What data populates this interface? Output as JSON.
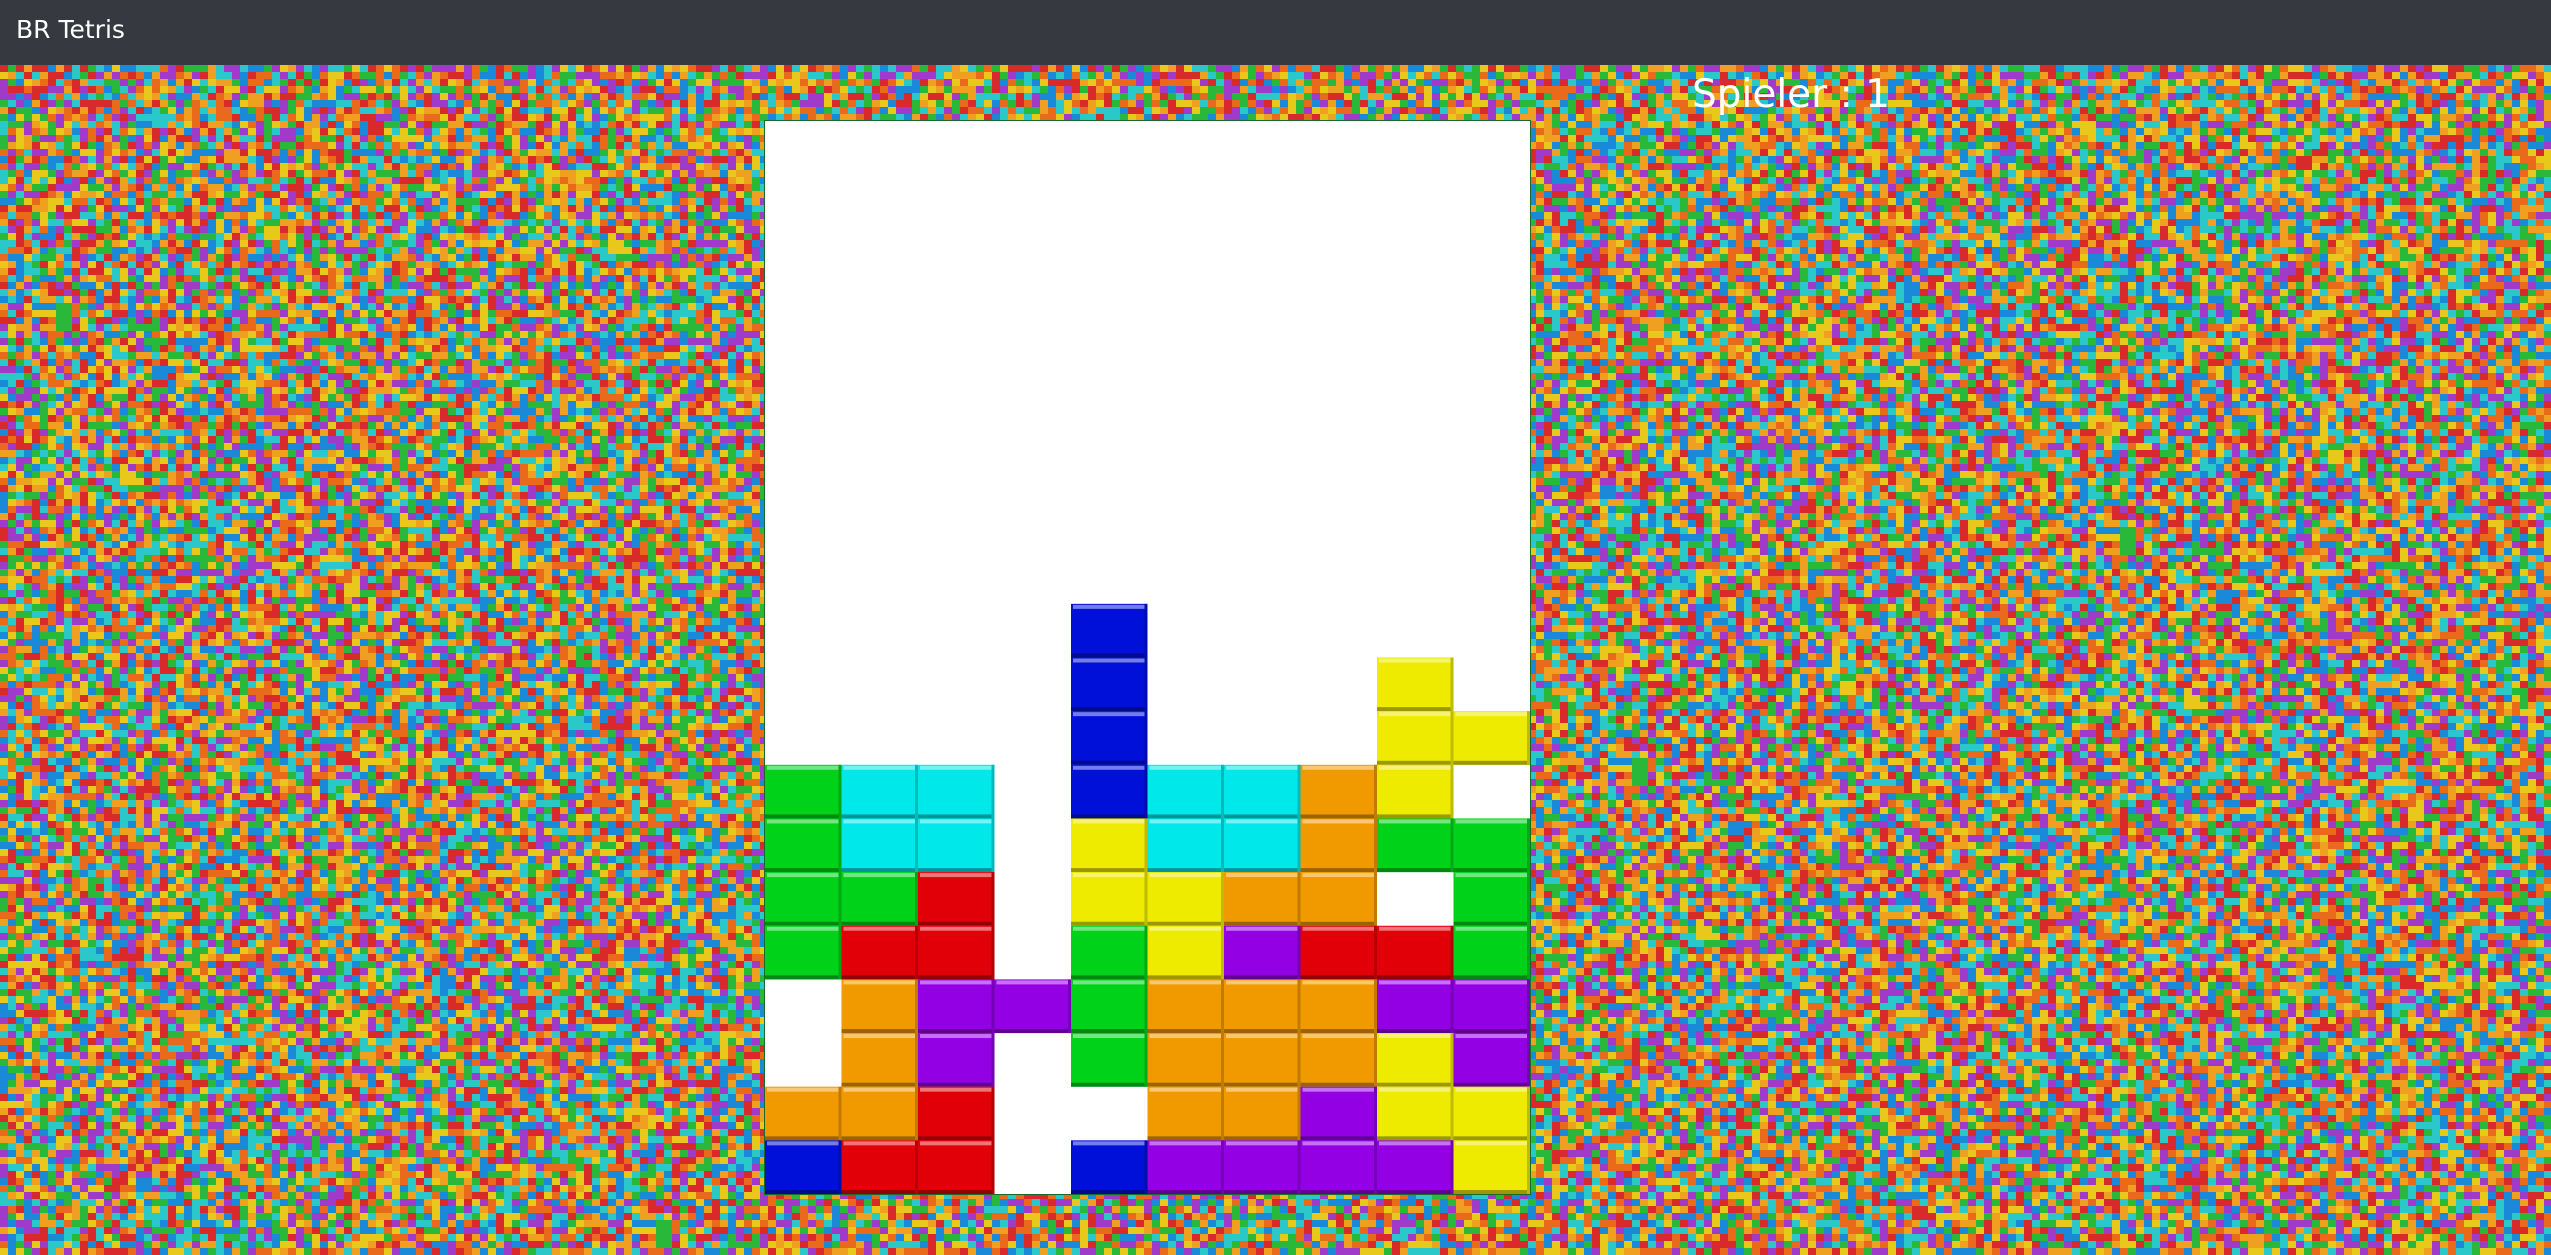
{
  "window": {
    "title": "BR Tetris"
  },
  "player": {
    "label": "Spieler : 1"
  },
  "colors": {
    "green": "#00d21a",
    "cyan": "#00e8ea",
    "blue": "#0010d8",
    "yellow": "#eeea00",
    "orange": "#f09a00",
    "red": "#e20008",
    "purple": "#9400e4",
    "background_palette": [
      "#e86a1a",
      "#1a8ad8",
      "#2ab83a",
      "#a03ac8",
      "#e8c81a",
      "#d82a2a",
      "#2ac8c8",
      "#f0a020"
    ]
  },
  "board": {
    "columns": 10,
    "rows": 20,
    "grid": [
      "..........",
      "..........",
      "..........",
      "..........",
      "..........",
      "..........",
      "..........",
      "..........",
      "..........",
      "....B.....",
      "....B...Y.",
      "....B...YY",
      "GCC.BCCOY.",
      "GCC.YCCOGG",
      "GGR.YYOO.G",
      "GRR.GYPRRG",
      ".OPPGOOOPP",
      ".OP.GOOOYP",
      "OOR..OOPYY",
      "BRR.BPPPPY"
    ]
  }
}
